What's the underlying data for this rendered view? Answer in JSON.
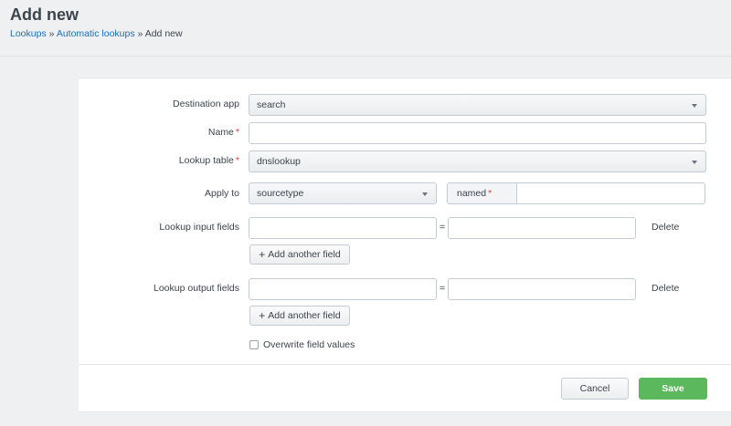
{
  "page": {
    "title": "Add new",
    "breadcrumb": {
      "items": [
        "Lookups",
        "Automatic lookups"
      ],
      "separator": "»",
      "current": "Add new"
    }
  },
  "form": {
    "destination_app": {
      "label": "Destination app",
      "value": "search"
    },
    "name": {
      "label": "Name",
      "required_mark": "*",
      "value": ""
    },
    "lookup_table": {
      "label": "Lookup table",
      "required_mark": "*",
      "value": "dnslookup"
    },
    "apply_to": {
      "label": "Apply to",
      "type_value": "sourcetype",
      "named_label": "named",
      "required_mark": "*",
      "named_value": ""
    },
    "lookup_input_fields": {
      "label": "Lookup input fields",
      "equals": "=",
      "delete_label": "Delete",
      "add_label": "Add another field",
      "add_icon": "+"
    },
    "lookup_output_fields": {
      "label": "Lookup output fields",
      "equals": "=",
      "delete_label": "Delete",
      "add_label": "Add another field",
      "add_icon": "+"
    },
    "overwrite": {
      "label": "Overwrite field values",
      "checked": false
    }
  },
  "footer": {
    "cancel_label": "Cancel",
    "save_label": "Save"
  },
  "colors": {
    "link": "#1e6fb8",
    "save_button": "#5cb85c",
    "required": "#d6443b"
  }
}
